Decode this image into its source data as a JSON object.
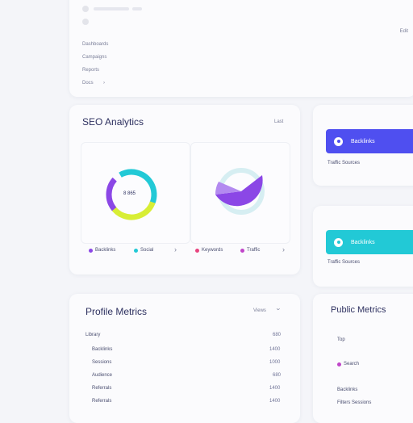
{
  "top_card": {
    "items": [
      "Dashboards",
      "Campaigns",
      "Reports",
      "Docs"
    ],
    "corner_label": "Edit"
  },
  "seo": {
    "title": "SEO Analytics",
    "action": "Last",
    "donut_center": "8 865",
    "legend_left": [
      "Backlinks",
      "Social"
    ],
    "legend_right": [
      "Keywords",
      "Traffic"
    ],
    "colors": {
      "teal": "#22c9d6",
      "purple": "#8b47e6",
      "lime": "#d8ee35",
      "light_teal": "#d6eef2"
    }
  },
  "side_actions": [
    {
      "label": "Backlinks",
      "caption": "Traffic Sources",
      "color": "#4f4ff0"
    },
    {
      "label": "Backlinks",
      "caption": "Traffic Sources",
      "color": "#22c9d6"
    }
  ],
  "profile": {
    "title": "Profile Metrics",
    "action": "Views",
    "rows": [
      {
        "label": "Library",
        "value": "680"
      },
      {
        "label": "Backlinks",
        "value": "1400"
      },
      {
        "label": "Sessions",
        "value": "1000"
      },
      {
        "label": "Audience",
        "value": "680"
      },
      {
        "label": "Referrals",
        "value": "1400"
      },
      {
        "label": "Referrals",
        "value": "1400"
      }
    ]
  },
  "public_metrics": {
    "title": "Public Metrics",
    "items": [
      "Top",
      "Search",
      "Backlinks",
      "Filters Sessions"
    ]
  }
}
